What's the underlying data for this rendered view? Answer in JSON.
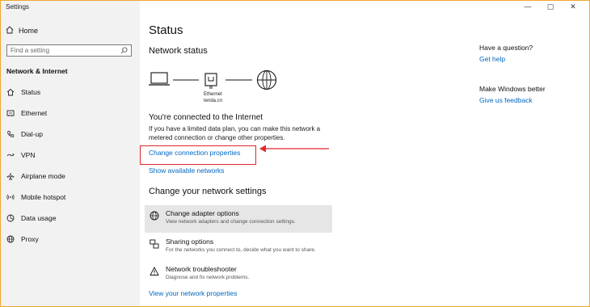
{
  "window": {
    "title": "Settings",
    "controls": [
      "—",
      "▢",
      "✕"
    ]
  },
  "sidebar": {
    "home_label": "Home",
    "search_placeholder": "Find a setting",
    "section_title": "Network & Internet",
    "items": [
      {
        "label": "Status",
        "icon": "home-status-icon"
      },
      {
        "label": "Ethernet",
        "icon": "ethernet-icon"
      },
      {
        "label": "Dial-up",
        "icon": "phone-icon"
      },
      {
        "label": "VPN",
        "icon": "vpn-icon"
      },
      {
        "label": "Airplane mode",
        "icon": "airplane-icon"
      },
      {
        "label": "Mobile hotspot",
        "icon": "hotspot-icon"
      },
      {
        "label": "Data usage",
        "icon": "data-usage-icon"
      },
      {
        "label": "Proxy",
        "icon": "globe-icon"
      }
    ]
  },
  "main": {
    "title": "Status",
    "network_status": "Network status",
    "ethernet_label": "Ethernet",
    "network_name": "tenda.cn",
    "connected_text": "You're connected to the Internet",
    "description": "If you have a limited data plan, you can make this network a metered connection or change other properties.",
    "change_connection_link": "Change connection properties",
    "show_networks_link": "Show available networks",
    "change_settings_title": "Change your network settings",
    "options": [
      {
        "title": "Change adapter options",
        "desc": "View network adapters and change connection settings."
      },
      {
        "title": "Sharing options",
        "desc": "For the networks you connect to, decide what you want to share."
      },
      {
        "title": "Network troubleshooter",
        "desc": "Diagnose and fix network problems."
      }
    ],
    "view_properties_link": "View your network properties"
  },
  "right_panel": {
    "question": "Have a question?",
    "help_link": "Get help",
    "better": "Make Windows better",
    "feedback_link": "Give us feedback"
  },
  "annotation_color": "#e0282e",
  "accent_color": "#0067c0"
}
